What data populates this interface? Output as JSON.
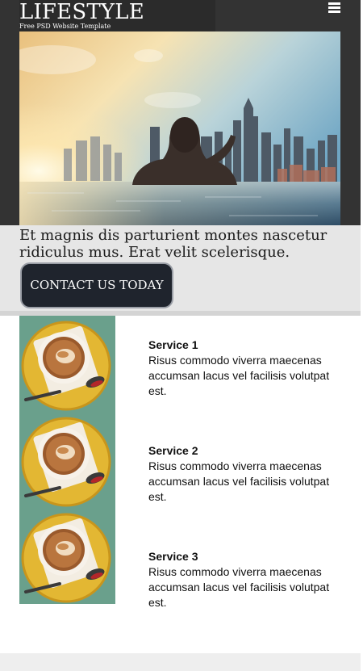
{
  "header": {
    "logo_title": "LIFESTYLE",
    "logo_subtitle": "Free PSD Website Template",
    "menu_icon": "hamburger-menu-icon"
  },
  "hero": {
    "image": "woman-in-infinity-pool-city-skyline-sunset"
  },
  "banner": {
    "text": "Et magnis dis parturient montes nascetur ridiculus mus. Erat velit scelerisque.",
    "cta_label": "CONTACT US TODAY"
  },
  "services": [
    {
      "title": "Service 1",
      "description": "Risus commodo viverra maecenas accumsan lacus vel facilisis volutpat est.",
      "image": "coffee-cup-latte-art"
    },
    {
      "title": "Service 2",
      "description": "Risus commodo viverra maecenas accumsan lacus vel facilisis volutpat est.",
      "image": "coffee-cup-latte-art"
    },
    {
      "title": "Service 3",
      "description": "Risus commodo viverra maecenas accumsan lacus vel facilisis volutpat est.",
      "image": "coffee-cup-latte-art"
    }
  ],
  "colors": {
    "header_bg": "#333333",
    "banner_bg": "#e6e6e6",
    "button_bg": "#1f242d",
    "footer_bg": "#eeeeee"
  }
}
